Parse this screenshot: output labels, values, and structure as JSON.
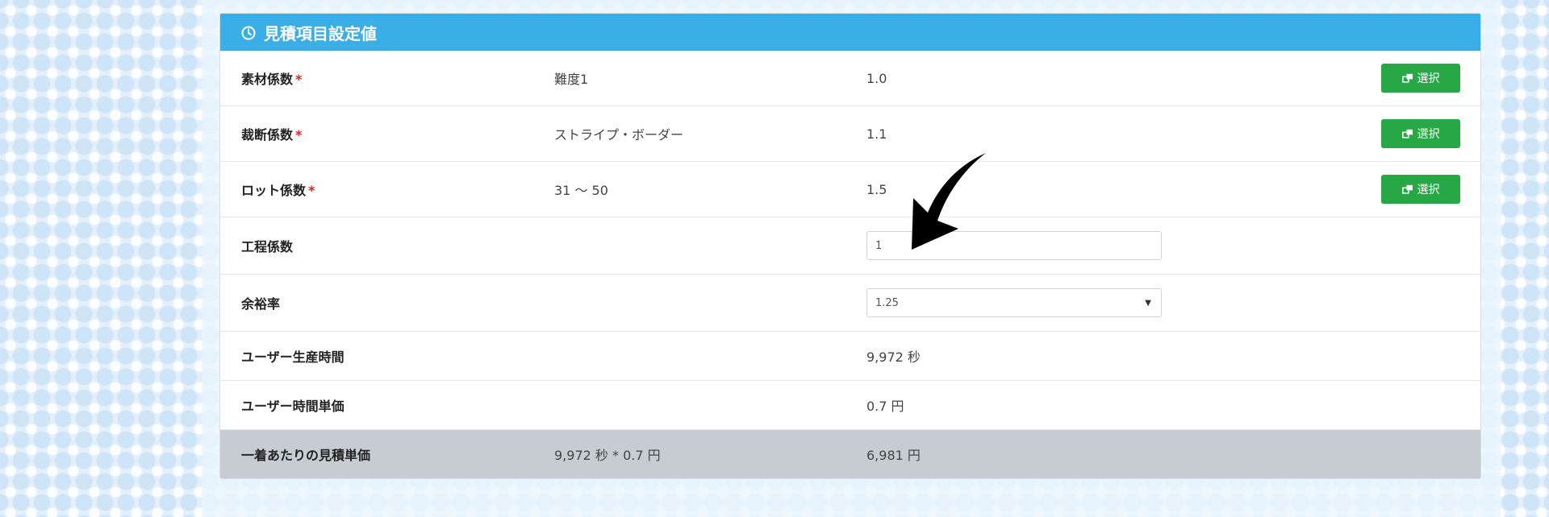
{
  "panel": {
    "title": "見積項目設定値",
    "title_icon": "clock-icon",
    "header_color": "#3aaee6"
  },
  "rows": [
    {
      "label": "素材係数",
      "required": true,
      "description": "難度1",
      "value": "1.0",
      "button": "選択"
    },
    {
      "label": "裁断係数",
      "required": true,
      "description": "ストライプ・ボーダー",
      "value": "1.1",
      "button": "選択"
    },
    {
      "label": "ロット係数",
      "required": true,
      "description": "31 ～ 50",
      "value": "1.5",
      "button": "選択"
    },
    {
      "label": "工程係数",
      "input_value": "1"
    },
    {
      "label": "余裕率",
      "select_value": "1.25"
    },
    {
      "label": "ユーザー生産時間",
      "value": "9,972 秒"
    },
    {
      "label": "ユーザー時間単価",
      "value": "0.7 円"
    },
    {
      "label": "一着あたりの見積単価",
      "description": "9,972 秒 * 0.7 円",
      "value": "6,981 円"
    }
  ],
  "required_mark": "*",
  "colors": {
    "button_green": "#28a745",
    "required_red": "#e02424",
    "total_row_bg": "#c6ccd1"
  }
}
